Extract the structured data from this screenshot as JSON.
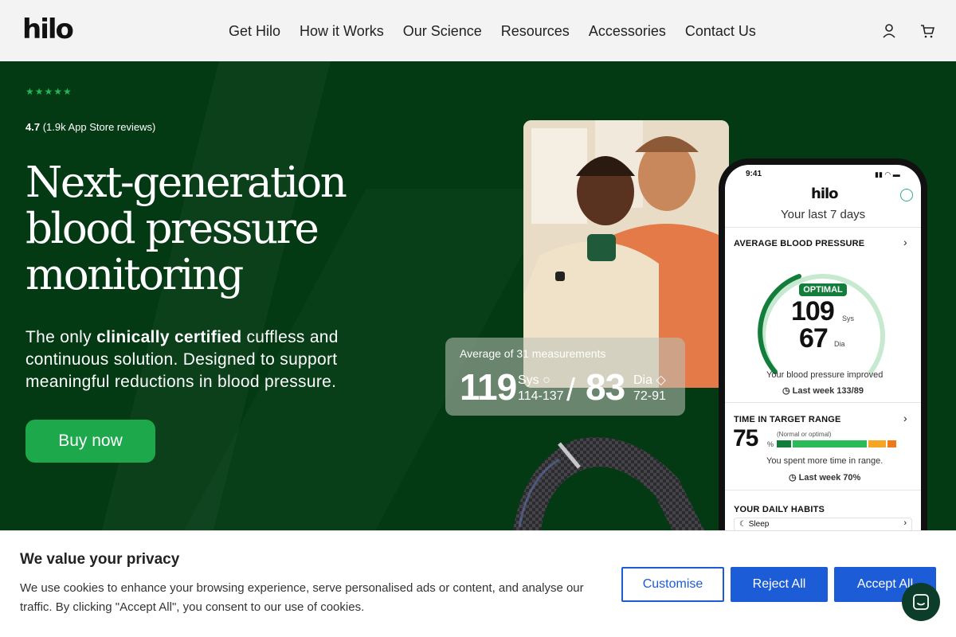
{
  "header": {
    "logo": "hilo",
    "nav": [
      "Get Hilo",
      "How it Works",
      "Our Science",
      "Resources",
      "Accessories",
      "Contact Us"
    ],
    "icons": [
      "user-icon",
      "cart-icon"
    ]
  },
  "hero": {
    "stars": "★★★★★",
    "rating_value": "4.7",
    "rating_text": "(1.9k App Store reviews)",
    "title": "Next-generation blood pressure monitoring",
    "subtitle_pre": "The only ",
    "subtitle_bold": "clinically certified",
    "subtitle_post": " cuffless and continuous solution. Designed to support meaningful reductions in blood pressure.",
    "cta": "Buy now"
  },
  "measurement_card": {
    "label": "Average of 31 measurements",
    "sys_value": "119",
    "sys_label": "Sys",
    "sys_range": "114-137",
    "slash": "/",
    "dia_value": "83",
    "dia_label": "Dia",
    "dia_range": "72-91"
  },
  "phone": {
    "time": "9:41",
    "logo": "hilo",
    "subtitle": "Your last 7 days",
    "avg_title": "AVERAGE BLOOD PRESSURE",
    "badge": "OPTIMAL",
    "sys_value": "109",
    "sys_unit": "Sys",
    "dia_value": "67",
    "dia_unit": "Dia",
    "improved_text": "Your blood pressure improved",
    "last_week_bp": "Last week 133/89",
    "range_title": "TIME IN TARGET RANGE",
    "range_value": "75",
    "range_unit": "%",
    "range_note": "(Normal or optimal)",
    "range_text": "You spent more time in range.",
    "range_last_week": "Last week 70%",
    "range_fraction": 0.75,
    "habits_title": "YOUR DAILY HABITS",
    "habit_item": "Sleep"
  },
  "cookie": {
    "title": "We value your privacy",
    "text": "We use cookies to enhance your browsing experience, serve personalised ads or content, and analyse our traffic. By clicking \"Accept All\", you consent to our use of cookies.",
    "customise": "Customise",
    "reject": "Reject All",
    "accept": "Accept All"
  },
  "colors": {
    "hero_bg": "#033a13",
    "accent_green": "#1ea84c",
    "cookie_blue": "#1c5cd6"
  }
}
